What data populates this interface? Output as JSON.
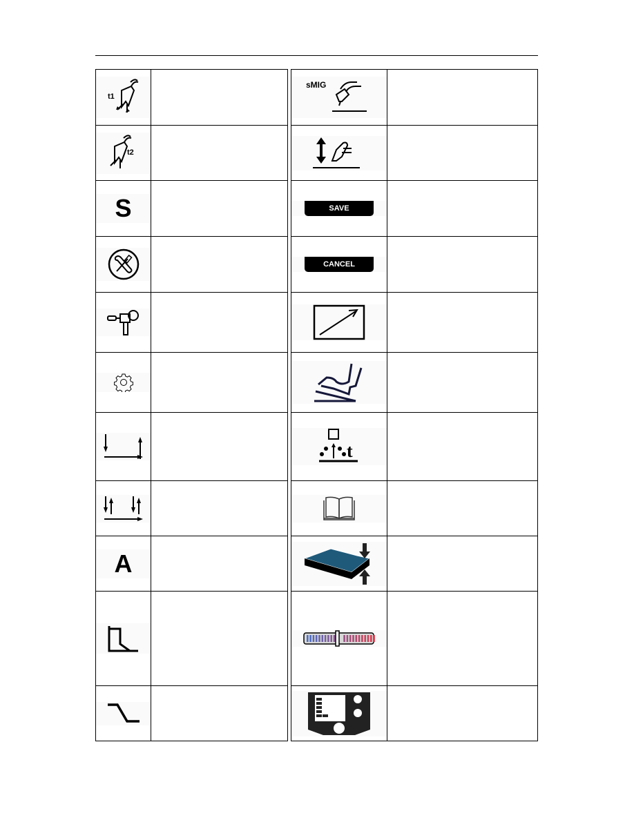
{
  "document": {
    "type": "welding-machine symbol reference table",
    "left_column": [
      {
        "icon": "torch-trigger-t1-icon",
        "label": "t1",
        "description": ""
      },
      {
        "icon": "torch-trigger-t2-icon",
        "label": "t2",
        "description": ""
      },
      {
        "icon": "letter-s-icon",
        "label": "S",
        "description": ""
      },
      {
        "icon": "tools-service-icon",
        "label": "",
        "description": ""
      },
      {
        "icon": "spot-weld-gun-icon",
        "label": "",
        "description": ""
      },
      {
        "icon": "gear-settings-icon",
        "label": "",
        "description": ""
      },
      {
        "icon": "2-stroke-icon",
        "label": "",
        "description": ""
      },
      {
        "icon": "4-stroke-icon",
        "label": "",
        "description": ""
      },
      {
        "icon": "letter-a-icon",
        "label": "A",
        "description": ""
      },
      {
        "icon": "crater-fill-icon",
        "label": "",
        "description": ""
      },
      {
        "icon": "downslope-icon",
        "label": "",
        "description": ""
      }
    ],
    "right_column": [
      {
        "icon": "smig-torch-icon",
        "label": "sMIG",
        "description": ""
      },
      {
        "icon": "arc-length-icon",
        "label": "",
        "description": ""
      },
      {
        "icon": "save-button-icon",
        "label": "SAVE",
        "description": ""
      },
      {
        "icon": "cancel-button-icon",
        "label": "CANCEL",
        "description": ""
      },
      {
        "icon": "remote-control-arrow-icon",
        "label": "",
        "description": ""
      },
      {
        "icon": "foot-pedal-icon",
        "label": "",
        "description": ""
      },
      {
        "icon": "pre-gas-time-icon",
        "label": "t",
        "description": ""
      },
      {
        "icon": "manual-book-icon",
        "label": "",
        "description": ""
      },
      {
        "icon": "plate-thickness-icon",
        "label": "",
        "description": ""
      },
      {
        "icon": "fine-tuning-slider-icon",
        "label": "",
        "description": ""
      },
      {
        "icon": "control-panel-icon",
        "label": "",
        "description": ""
      }
    ]
  },
  "colors": {
    "plate_blue": "#1f5a7a",
    "slider_blue": "#4a6fc4",
    "slider_red": "#e03a4a",
    "pedal_navy": "#16183a"
  }
}
